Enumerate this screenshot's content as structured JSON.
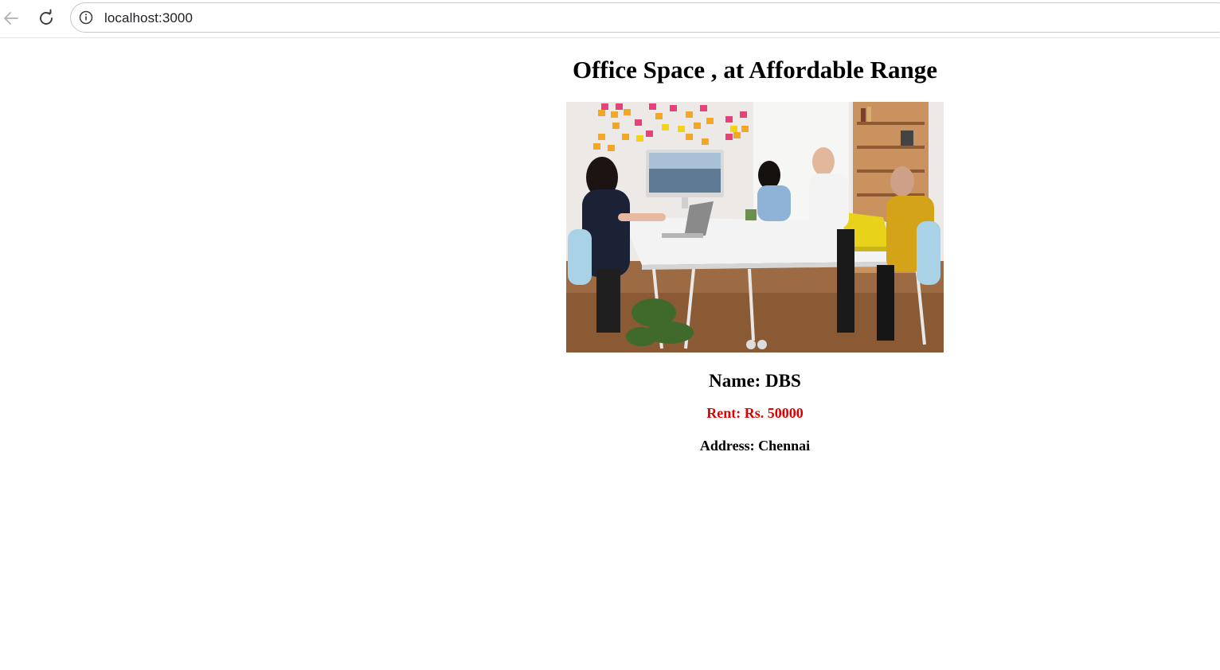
{
  "browser": {
    "url": "localhost:3000",
    "icons": {
      "back": "arrow-left-icon",
      "reload": "reload-icon",
      "info": "info-icon"
    }
  },
  "page": {
    "heading": "Office Space , at Affordable Range",
    "image_alt": "Office meeting room with people working at a white table",
    "name_line": "Name: DBS",
    "rent_line": "Rent: Rs. 50000",
    "address_line": "Address: Chennai",
    "colors": {
      "rent": "#e00000",
      "text": "#000000"
    }
  }
}
